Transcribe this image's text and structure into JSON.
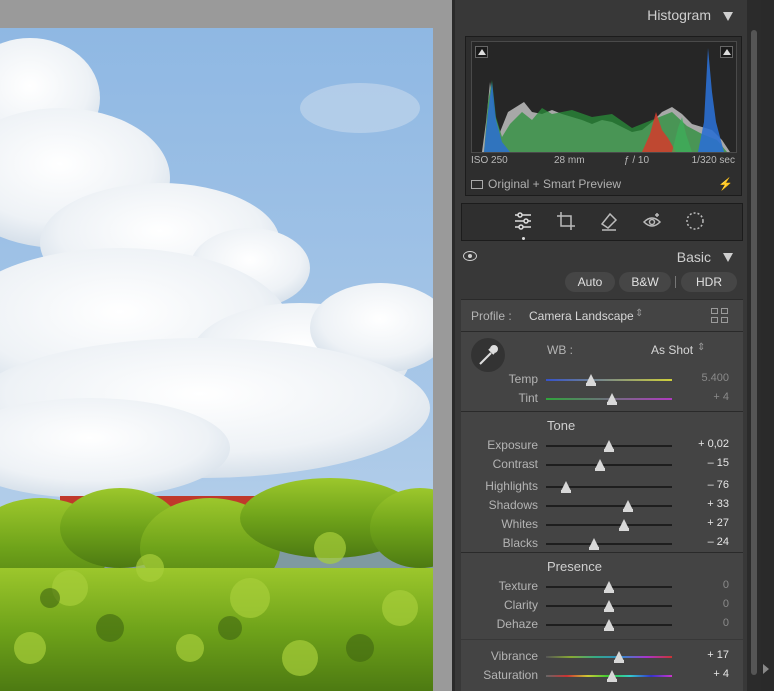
{
  "histogram": {
    "title": "Histogram",
    "exif": {
      "iso": "ISO 250",
      "focal": "28 mm",
      "aperture": "ƒ / 10",
      "shutter": "1/320 sec"
    },
    "preview": "Original + Smart Preview"
  },
  "toolstrip": {
    "tools": [
      "edit-sliders",
      "crop",
      "healing",
      "red-eye",
      "masking"
    ],
    "active": "edit-sliders"
  },
  "basic": {
    "title": "Basic",
    "buttons": {
      "auto": "Auto",
      "bw": "B&W",
      "hdr": "HDR"
    },
    "profile": {
      "label": "Profile :",
      "value": "Camera Landscape"
    },
    "wb": {
      "label": "WB :",
      "value": "As Shot",
      "temp": {
        "label": "Temp",
        "value": "5.400",
        "position": 0.36
      },
      "tint": {
        "label": "Tint",
        "value": "+ 4",
        "position": 0.52
      }
    },
    "tone": {
      "title": "Tone",
      "exposure": {
        "label": "Exposure",
        "value": "+ 0,02",
        "position": 0.5
      },
      "contrast": {
        "label": "Contrast",
        "value": "– 15",
        "position": 0.43
      },
      "highlights": {
        "label": "Highlights",
        "value": "– 76",
        "position": 0.16
      },
      "shadows": {
        "label": "Shadows",
        "value": "+ 33",
        "position": 0.65
      },
      "whites": {
        "label": "Whites",
        "value": "+ 27",
        "position": 0.62
      },
      "blacks": {
        "label": "Blacks",
        "value": "– 24",
        "position": 0.38
      }
    },
    "presence": {
      "title": "Presence",
      "texture": {
        "label": "Texture",
        "value": "0",
        "position": 0.5
      },
      "clarity": {
        "label": "Clarity",
        "value": "0",
        "position": 0.5
      },
      "dehaze": {
        "label": "Dehaze",
        "value": "0",
        "position": 0.5
      },
      "vibrance": {
        "label": "Vibrance",
        "value": "+ 17",
        "position": 0.58
      },
      "saturation": {
        "label": "Saturation",
        "value": "+ 4",
        "position": 0.52
      }
    }
  },
  "colors": {
    "panel_bg": "#383838",
    "block_bg": "#444444",
    "sky": "#9ec3e6",
    "foliage": "#7fb21e"
  }
}
